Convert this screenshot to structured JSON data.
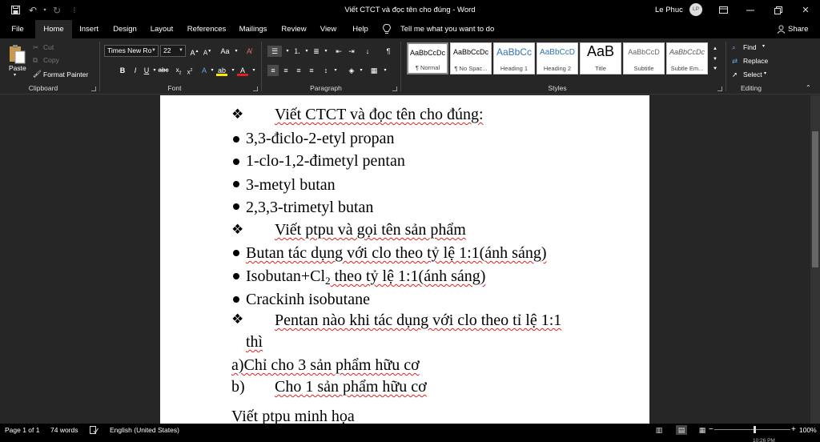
{
  "titlebar": {
    "title": "Viết CTCT và đọc tên cho đúng - Word",
    "user_name": "Le Phuc",
    "avatar_initials": "LP",
    "quick_access": [
      "save-icon",
      "undo-icon",
      "redo-icon",
      "customize-icon"
    ]
  },
  "tabs": [
    "File",
    "Home",
    "Insert",
    "Design",
    "Layout",
    "References",
    "Mailings",
    "Review",
    "View",
    "Help"
  ],
  "active_tab": "Home",
  "tellme": "Tell me what you want to do",
  "share": "Share",
  "clipboard": {
    "paste": "Paste",
    "cut": "Cut",
    "copy": "Copy",
    "format_painter": "Format Painter",
    "group": "Clipboard"
  },
  "font": {
    "name": "Times New Ro",
    "size": "22",
    "group": "Font"
  },
  "paragraph": {
    "group": "Paragraph"
  },
  "styles": {
    "group": "Styles",
    "items": [
      {
        "sample": "AaBbCcDc",
        "name": "¶ Normal"
      },
      {
        "sample": "AaBbCcDc",
        "name": "¶ No Spac..."
      },
      {
        "sample": "AaBbCc",
        "name": "Heading 1"
      },
      {
        "sample": "AaBbCcD",
        "name": "Heading 2"
      },
      {
        "sample": "AaB",
        "name": "Title"
      },
      {
        "sample": "AaBbCcD",
        "name": "Subtitle"
      },
      {
        "sample": "AaBbCcDc",
        "name": "Subtle Em..."
      }
    ]
  },
  "editing": {
    "group": "Editing",
    "find": "Find",
    "replace": "Replace",
    "select": "Select"
  },
  "document": {
    "heading1": "Viết CTCT và đọc tên cho đúng:",
    "list1": [
      "3,3-điclo-2-etyl propan",
      "1-clo-1,2-đimetyl pentan",
      "3-metyl butan",
      "2,3,3-trimetyl butan"
    ],
    "heading2": "Viết ptpu và gọi tên sản phẩm",
    "list2_1": "Butan tác dụng với clo theo tỷ lệ 1:1(ánh sáng)",
    "list2_2a": "Isobutan+Cl",
    "list2_2sub": "2",
    "list2_2b": " theo tỷ lệ 1:1(ánh sáng)",
    "list2_3": "Crackinh isobutane",
    "heading3a": "Pentan nào khi tác dụng với clo theo tỉ lệ 1:1",
    "heading3b": "thì",
    "item_a": "a)Chỉ cho 3 sản phẩm hữu cơ",
    "item_b_label": "b)",
    "item_b": "Cho 1 sản phẩm hữu cơ",
    "last_line": "Viết ptpu minh họa"
  },
  "statusbar": {
    "page": "Page 1 of 1",
    "words": "74 words",
    "language": "English (United States)",
    "zoom": "100%",
    "time": "10:26 PM"
  }
}
